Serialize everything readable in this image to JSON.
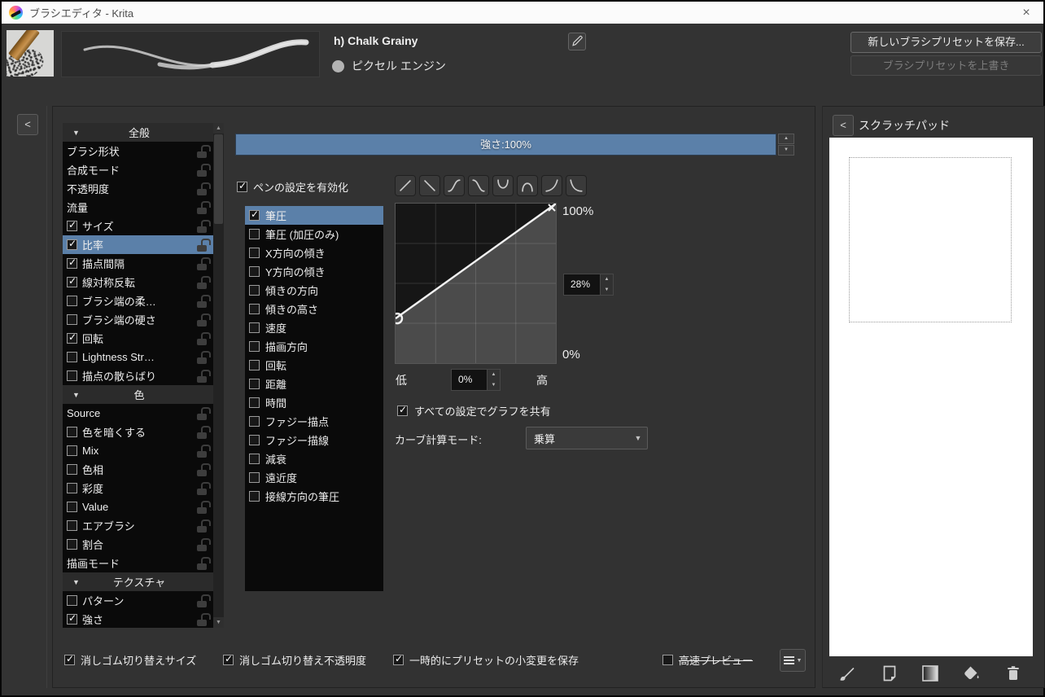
{
  "titlebar": {
    "title": "ブラシエディタ - Krita",
    "close": "×"
  },
  "header": {
    "preset_name": "h) Chalk Grainy",
    "engine": "ピクセル エンジン",
    "save_new_button": "新しいブラシプリセットを保存...",
    "overwrite_button": "ブラシプリセットを上書き"
  },
  "preset_list": [
    {
      "type": "header",
      "label": "全般"
    },
    {
      "type": "item",
      "label": "ブラシ形状",
      "checkbox": false
    },
    {
      "type": "item",
      "label": "合成モード",
      "checkbox": false
    },
    {
      "type": "item",
      "label": "不透明度",
      "checkbox": false
    },
    {
      "type": "item",
      "label": "流量",
      "checkbox": false
    },
    {
      "type": "item",
      "label": "サイズ",
      "checkbox": true,
      "checked": true
    },
    {
      "type": "item",
      "label": "比率",
      "checkbox": true,
      "checked": true,
      "selected": true
    },
    {
      "type": "item",
      "label": "描点間隔",
      "checkbox": true,
      "checked": true
    },
    {
      "type": "item",
      "label": "線対称反転",
      "checkbox": true,
      "checked": true
    },
    {
      "type": "item",
      "label": "ブラシ端の柔…",
      "checkbox": true,
      "checked": false
    },
    {
      "type": "item",
      "label": "ブラシ端の硬さ",
      "checkbox": true,
      "checked": false
    },
    {
      "type": "item",
      "label": "回転",
      "checkbox": true,
      "checked": true
    },
    {
      "type": "item",
      "label": "Lightness Str…",
      "checkbox": true,
      "checked": false
    },
    {
      "type": "item",
      "label": "描点の散らばり",
      "checkbox": true,
      "checked": false
    },
    {
      "type": "header",
      "label": "色"
    },
    {
      "type": "item",
      "label": "Source",
      "checkbox": false
    },
    {
      "type": "item",
      "label": "色を暗くする",
      "checkbox": true,
      "checked": false
    },
    {
      "type": "item",
      "label": "Mix",
      "checkbox": true,
      "checked": false
    },
    {
      "type": "item",
      "label": "色相",
      "checkbox": true,
      "checked": false
    },
    {
      "type": "item",
      "label": "彩度",
      "checkbox": true,
      "checked": false
    },
    {
      "type": "item",
      "label": "Value",
      "checkbox": true,
      "checked": false
    },
    {
      "type": "item",
      "label": "エアブラシ",
      "checkbox": true,
      "checked": false
    },
    {
      "type": "item",
      "label": "割合",
      "checkbox": true,
      "checked": false
    },
    {
      "type": "item",
      "label": "描画モード",
      "checkbox": false
    },
    {
      "type": "header",
      "label": "テクスチャ"
    },
    {
      "type": "item",
      "label": "パターン",
      "checkbox": true,
      "checked": false
    },
    {
      "type": "item",
      "label": "強さ",
      "checkbox": true,
      "checked": true
    }
  ],
  "strength": {
    "label": "強さ:100%"
  },
  "pen_settings": {
    "enable_label": "ペンの設定を有効化",
    "enabled": true
  },
  "curve_presets": [
    "linear-up",
    "linear-down",
    "s-curve",
    "reverse-s-curve",
    "u-curve",
    "arch-curve",
    "j-curve",
    "reverse-j-curve"
  ],
  "sensors": [
    {
      "label": "筆圧",
      "checked": true,
      "selected": true
    },
    {
      "label": "筆圧 (加圧のみ)",
      "checked": false
    },
    {
      "label": "X方向の傾き",
      "checked": false
    },
    {
      "label": "Y方向の傾き",
      "checked": false
    },
    {
      "label": "傾きの方向",
      "checked": false
    },
    {
      "label": "傾きの高さ",
      "checked": false
    },
    {
      "label": "速度",
      "checked": false
    },
    {
      "label": "描画方向",
      "checked": false
    },
    {
      "label": "回転",
      "checked": false
    },
    {
      "label": "距離",
      "checked": false
    },
    {
      "label": "時間",
      "checked": false
    },
    {
      "label": "ファジー描点",
      "checked": false
    },
    {
      "label": "ファジー描線",
      "checked": false
    },
    {
      "label": "減衰",
      "checked": false
    },
    {
      "label": "遠近度",
      "checked": false
    },
    {
      "label": "接線方向の筆圧",
      "checked": false
    }
  ],
  "curve": {
    "max_label": "100%",
    "min_label": "0%",
    "value_spin": "28%",
    "low_label": "低",
    "high_label": "高",
    "low_spin": "0%",
    "start_percent": 28,
    "end_percent": 100,
    "share_label": "すべての設定でグラフを共有",
    "share_checked": true,
    "mode_label": "カーブ計算モード:",
    "mode_value": "乗算"
  },
  "footer_checkboxes": [
    {
      "label": "消しゴム切り替えサイズ",
      "checked": true
    },
    {
      "label": "消しゴム切り替え不透明度",
      "checked": true
    },
    {
      "label": "一時的にプリセットの小変更を保存",
      "checked": true
    },
    {
      "label": "高速プレビュー",
      "checked": false,
      "strikethrough": true
    }
  ],
  "scratchpad": {
    "title": "スクラッチパッド",
    "tools": [
      "brush-icon",
      "page-icon",
      "gradient-icon",
      "fill-icon",
      "trash-icon"
    ]
  },
  "colors": {
    "accent": "#5b80a9",
    "titlebar": "#fbfbfb",
    "list_bg": "#0a0a0a"
  }
}
